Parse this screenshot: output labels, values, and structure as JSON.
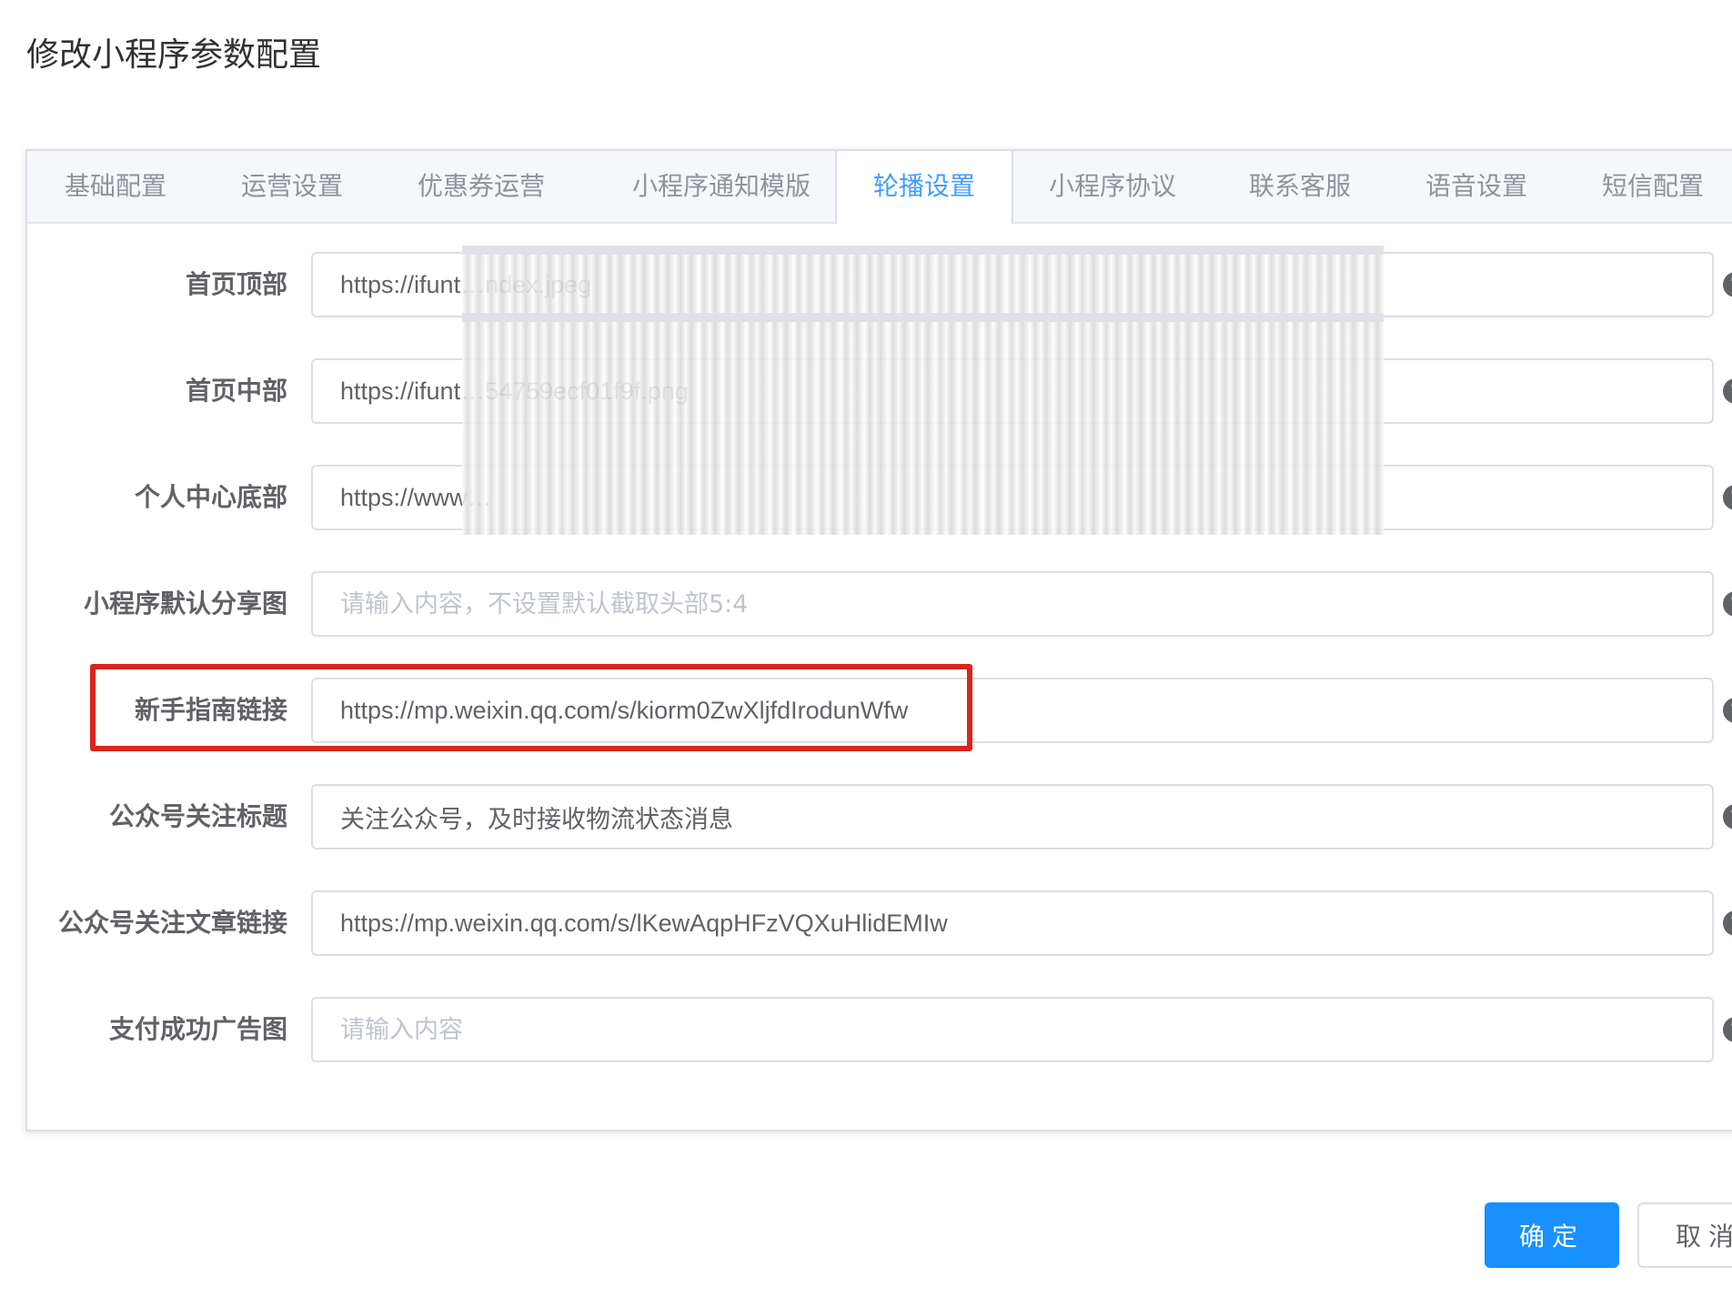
{
  "dialog": {
    "title": "修改小程序参数配置"
  },
  "tabs": [
    {
      "label": "基础配置"
    },
    {
      "label": "运营设置"
    },
    {
      "label": "优惠券运营"
    },
    {
      "label": "小程序通知模版"
    },
    {
      "label": "轮播设置",
      "active": true
    },
    {
      "label": "小程序协议"
    },
    {
      "label": "联系客服"
    },
    {
      "label": "语音设置"
    },
    {
      "label": "短信配置"
    }
  ],
  "form": {
    "fields": [
      {
        "label": "首页顶部",
        "value": "https://ifunt…ndex.jpeg",
        "placeholder": ""
      },
      {
        "label": "首页中部",
        "value": "https://ifunt…54759ecf01f9f.png",
        "placeholder": ""
      },
      {
        "label": "个人中心底部",
        "value": "https://www…",
        "placeholder": ""
      },
      {
        "label": "小程序默认分享图",
        "value": "",
        "placeholder": "请输入内容，不设置默认截取头部5:4"
      },
      {
        "label": "新手指南链接",
        "value": "https://mp.weixin.qq.com/s/kiorm0ZwXljfdIrodunWfw",
        "placeholder": ""
      },
      {
        "label": "公众号关注标题",
        "value": "关注公众号，及时接收物流状态消息",
        "placeholder": ""
      },
      {
        "label": "公众号关注文章链接",
        "value": "https://mp.weixin.qq.com/s/lKewAqpHFzVQXuHlidEMIw",
        "placeholder": ""
      },
      {
        "label": "支付成功广告图",
        "value": "",
        "placeholder": "请输入内容"
      }
    ],
    "help_icon": "question-circle-icon"
  },
  "footer": {
    "confirm_label": "确定",
    "cancel_label": "取消"
  },
  "colors": {
    "primary": "#1890ff",
    "active_tab": "#409eff",
    "highlight": "#d9251c"
  }
}
